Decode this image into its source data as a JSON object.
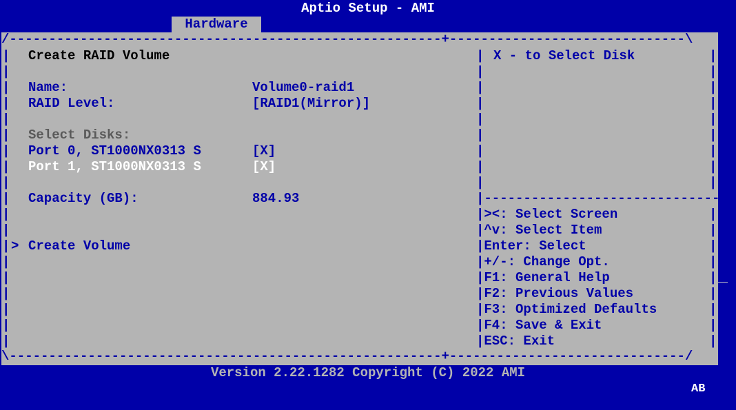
{
  "header": {
    "title": "Aptio Setup - AMI",
    "active_tab": "Hardware"
  },
  "frame": {
    "top": "/-------------------------------------------------------+------------------------------\\",
    "bottom": "\\-------------------------------------------------------+------------------------------/",
    "right_divider": "|------------------------------|",
    "bar": "|"
  },
  "main": {
    "section_title": "Create RAID Volume",
    "name_label": "Name:",
    "name_value": "Volume0-raid1",
    "raid_level_label": "RAID Level:",
    "raid_level_value": "[RAID1(Mirror)]",
    "select_disks_label": "Select Disks:",
    "disks": [
      {
        "label": "Port 0, ST1000NX0313 S",
        "value": "[X]"
      },
      {
        "label": "Port 1, ST1000NX0313 S",
        "value": "[X]"
      }
    ],
    "capacity_label": "Capacity (GB):",
    "capacity_value": "884.93",
    "cursor_marker": ">",
    "create_volume_label": "Create Volume"
  },
  "help": {
    "text": "X - to Select Disk"
  },
  "keys": [
    "><: Select Screen",
    "^v: Select Item",
    "Enter: Select",
    "+/-: Change Opt.",
    "F1: General Help",
    "F2: Previous Values",
    "F3: Optimized Defaults",
    "F4: Save & Exit",
    "ESC: Exit"
  ],
  "footer": {
    "version": "Version 2.22.1282 Copyright (C) 2022 AMI",
    "badge": "AB"
  },
  "colors": {
    "background": "#0000a8",
    "panel": "#b4b4b4",
    "text_blue": "#0000a8",
    "text_white": "#ffffff",
    "text_gray": "#5a5a5a"
  }
}
